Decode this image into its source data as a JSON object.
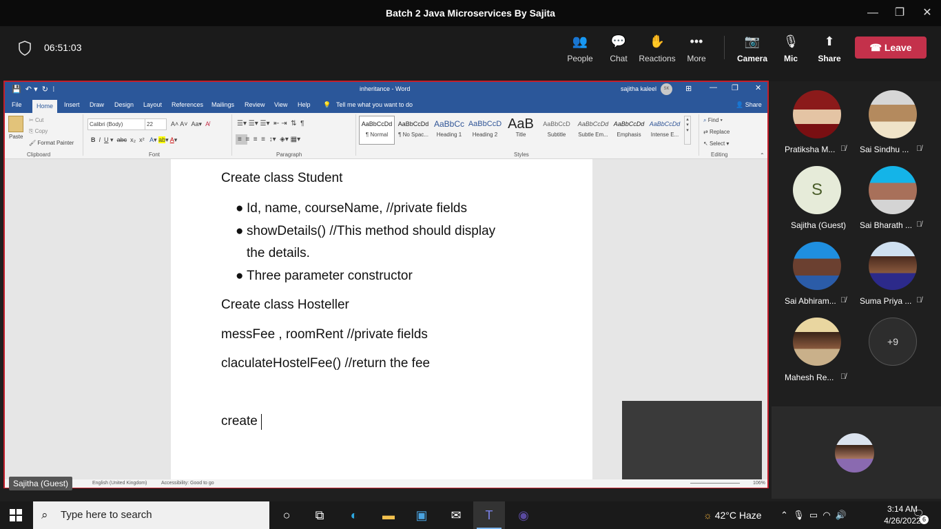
{
  "window": {
    "title": "Batch 2 Java Microservices By Sajita"
  },
  "meeting": {
    "timer": "06:51:03",
    "toolbar": [
      {
        "label": "People",
        "icon": "people-icon"
      },
      {
        "label": "Chat",
        "icon": "chat-icon"
      },
      {
        "label": "Reactions",
        "icon": "reactions-icon"
      },
      {
        "label": "More",
        "icon": "more-icon"
      },
      {
        "label": "Camera",
        "icon": "camera-off-icon"
      },
      {
        "label": "Mic",
        "icon": "mic-off-icon"
      },
      {
        "label": "Share",
        "icon": "share-icon"
      }
    ],
    "leave_label": "Leave",
    "presenter_label": "Sajitha (Guest)"
  },
  "word": {
    "title": "inheritance  -  Word",
    "user": "sajitha kaleel",
    "user_initials": "SK",
    "tabs": [
      "File",
      "Home",
      "Insert",
      "Draw",
      "Design",
      "Layout",
      "References",
      "Mailings",
      "Review",
      "View",
      "Help"
    ],
    "tell_me": "Tell me what you want to do",
    "share": "Share",
    "clipboard": {
      "paste": "Paste",
      "cut": "Cut",
      "copy": "Copy",
      "format_painter": "Format Painter",
      "group": "Clipboard"
    },
    "font": {
      "name": "Calibri (Body)",
      "size": "22",
      "group": "Font"
    },
    "paragraph_group": "Paragraph",
    "styles": [
      {
        "sample": "AaBbCcDd",
        "name": "¶ Normal"
      },
      {
        "sample": "AaBbCcDd",
        "name": "¶ No Spac..."
      },
      {
        "sample": "AaBbCc",
        "name": "Heading 1"
      },
      {
        "sample": "AaBbCcD",
        "name": "Heading 2"
      },
      {
        "sample": "AaB",
        "name": "Title"
      },
      {
        "sample": "AaBbCcD",
        "name": "Subtitle"
      },
      {
        "sample": "AaBbCcDd",
        "name": "Subtle Em..."
      },
      {
        "sample": "AaBbCcDd",
        "name": "Emphasis"
      },
      {
        "sample": "AaBbCcDd",
        "name": "Intense E..."
      }
    ],
    "styles_group": "Styles",
    "editing": {
      "find": "Find",
      "replace": "Replace",
      "select": "Select",
      "group": "Editing"
    },
    "document": {
      "heading1": "Create class Student",
      "bullets": [
        "Id, name, courseName,  //private fields",
        "showDetails() //This method  should display",
        "the details.",
        "Three parameter constructor"
      ],
      "heading2": "Create class Hosteller",
      "line1": "messFee , roomRent //private fields",
      "line2": "claculateHostelFee() //return the fee",
      "line3": "create"
    },
    "status": {
      "language": "English (United Kingdom)",
      "accessibility": "Accessibility: Good to go",
      "zoom": "106%"
    }
  },
  "participants": [
    {
      "name": "Pratiksha M...",
      "muted": true
    },
    {
      "name": "Sai Sindhu ...",
      "muted": true
    },
    {
      "name": "Sajitha (Guest)",
      "initial": "S",
      "muted": false
    },
    {
      "name": "Sai Bharath ...",
      "muted": true
    },
    {
      "name": "Sai Abhiram...",
      "muted": true
    },
    {
      "name": "Suma Priya ...",
      "muted": true
    },
    {
      "name": "Mahesh Re...",
      "muted": true
    }
  ],
  "more_participants": "+9",
  "taskbar": {
    "search_placeholder": "Type here to search",
    "weather": "42°C  Haze",
    "time": "3:14 AM",
    "date": "4/26/2022",
    "notifications": "6"
  },
  "colors": {
    "word_blue": "#2b579a",
    "leave_red": "#c4314b",
    "frame_red": "#c41e2b"
  }
}
